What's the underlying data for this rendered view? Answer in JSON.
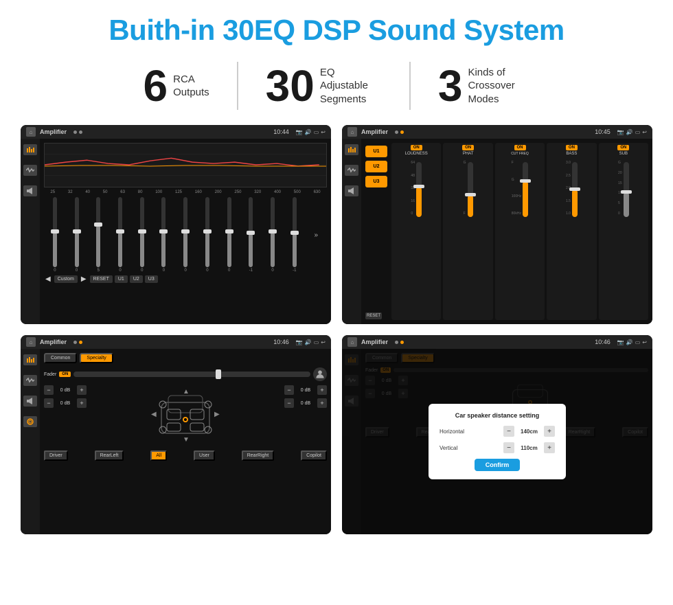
{
  "title": "Buith-in 30EQ DSP Sound System",
  "stats": [
    {
      "number": "6",
      "label": "RCA\nOutputs"
    },
    {
      "number": "30",
      "label": "EQ Adjustable\nSegments"
    },
    {
      "number": "3",
      "label": "Kinds of\nCrossover Modes"
    }
  ],
  "screens": [
    {
      "id": "eq-screen",
      "statusTitle": "Amplifier",
      "time": "10:44",
      "eqLabels": [
        "25",
        "32",
        "40",
        "50",
        "63",
        "80",
        "100",
        "125",
        "160",
        "200",
        "250",
        "320",
        "400",
        "500",
        "630"
      ],
      "eqValues": [
        "0",
        "0",
        "0",
        "5",
        "0",
        "0",
        "0",
        "0",
        "0",
        "0",
        "0",
        "-1",
        "0",
        "-1"
      ],
      "bottomBtns": [
        "Custom",
        "RESET",
        "U1",
        "U2",
        "U3"
      ]
    },
    {
      "id": "amp-screen",
      "statusTitle": "Amplifier",
      "time": "10:45",
      "presets": [
        "U1",
        "U2",
        "U3"
      ],
      "channels": [
        {
          "name": "LOUDNESS",
          "on": true
        },
        {
          "name": "PHAT",
          "on": true
        },
        {
          "name": "CUT FREQ",
          "on": true
        },
        {
          "name": "BASS",
          "on": true
        },
        {
          "name": "SUB",
          "on": true
        }
      ],
      "resetBtn": "RESET"
    },
    {
      "id": "fader-screen",
      "statusTitle": "Amplifier",
      "time": "10:46",
      "tabs": [
        "Common",
        "Specialty"
      ],
      "activeTab": "Specialty",
      "faderLabel": "Fader",
      "faderOn": "ON",
      "volumes": [
        {
          "label": "",
          "value": "0 dB"
        },
        {
          "label": "",
          "value": "0 dB"
        },
        {
          "label": "",
          "value": "0 dB"
        },
        {
          "label": "",
          "value": "0 dB"
        }
      ],
      "buttons": [
        "Driver",
        "RearLeft",
        "All",
        "User",
        "RearRight",
        "Copilot"
      ]
    },
    {
      "id": "dialog-screen",
      "statusTitle": "Amplifier",
      "time": "10:46",
      "tabs": [
        "Common",
        "Specialty"
      ],
      "dialog": {
        "title": "Car speaker distance setting",
        "fields": [
          {
            "label": "Horizontal",
            "value": "140cm"
          },
          {
            "label": "Vertical",
            "value": "110cm"
          }
        ],
        "confirmBtn": "Confirm"
      }
    }
  ],
  "colors": {
    "accent": "#1a9de0",
    "orange": "#f90",
    "dark": "#1a1a1a",
    "text": "#1a1a1a"
  }
}
